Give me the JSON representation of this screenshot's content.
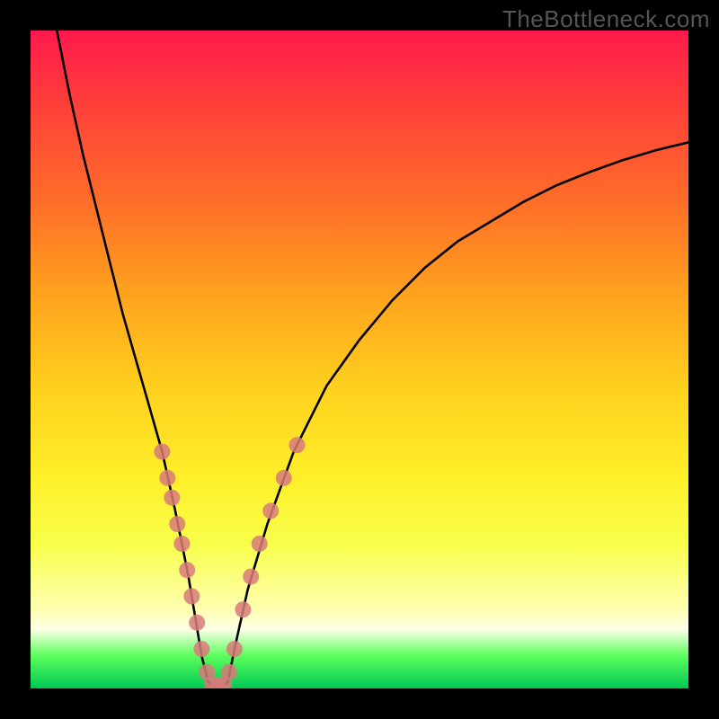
{
  "watermark": "TheBottleneck.com",
  "chart_data": {
    "type": "line",
    "title": "",
    "xlabel": "",
    "ylabel": "",
    "xlim": [
      0,
      100
    ],
    "ylim": [
      0,
      100
    ],
    "series": [
      {
        "name": "bottleneck-curve",
        "x": [
          4,
          6,
          8,
          10,
          12,
          14,
          16,
          18,
          20,
          22,
          23,
          24,
          25,
          26,
          27,
          28,
          29,
          30,
          31,
          33,
          36,
          40,
          45,
          50,
          55,
          60,
          65,
          70,
          75,
          80,
          85,
          90,
          95,
          100
        ],
        "y": [
          100,
          90,
          81,
          73,
          65,
          57,
          50,
          43,
          36,
          27,
          22,
          17,
          11,
          5,
          1,
          0,
          0,
          1,
          6,
          15,
          25,
          36,
          46,
          53,
          59,
          64,
          68,
          71,
          74,
          76.5,
          78.5,
          80.3,
          81.8,
          83
        ]
      }
    ],
    "markers": {
      "name": "highlight-dots",
      "color": "#d87a7a",
      "points": [
        {
          "x": 20.0,
          "y": 36
        },
        {
          "x": 20.8,
          "y": 32
        },
        {
          "x": 21.5,
          "y": 29
        },
        {
          "x": 22.3,
          "y": 25
        },
        {
          "x": 23.0,
          "y": 22
        },
        {
          "x": 23.8,
          "y": 18
        },
        {
          "x": 24.5,
          "y": 14
        },
        {
          "x": 25.3,
          "y": 10
        },
        {
          "x": 26.0,
          "y": 6
        },
        {
          "x": 26.8,
          "y": 2.5
        },
        {
          "x": 27.6,
          "y": 0.7
        },
        {
          "x": 28.5,
          "y": 0.3
        },
        {
          "x": 29.4,
          "y": 0.7
        },
        {
          "x": 30.2,
          "y": 2.5
        },
        {
          "x": 31.0,
          "y": 6
        },
        {
          "x": 32.3,
          "y": 12
        },
        {
          "x": 33.5,
          "y": 17
        },
        {
          "x": 34.8,
          "y": 22
        },
        {
          "x": 36.5,
          "y": 27
        },
        {
          "x": 38.5,
          "y": 32
        },
        {
          "x": 40.5,
          "y": 37
        }
      ]
    },
    "gradient_bands": [
      {
        "color": "#ff1a4d",
        "stop": 0
      },
      {
        "color": "#ffd21e",
        "stop": 55
      },
      {
        "color": "#ffffe8",
        "stop": 91
      },
      {
        "color": "#00c853",
        "stop": 100
      }
    ]
  }
}
